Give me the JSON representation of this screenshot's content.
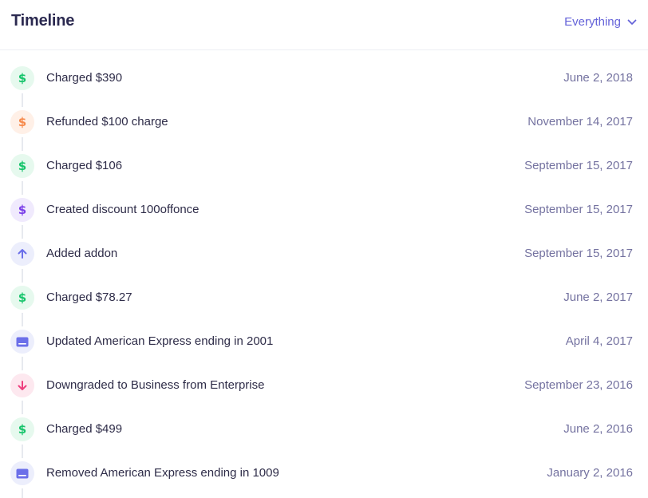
{
  "header": {
    "title": "Timeline",
    "filter_label": "Everything"
  },
  "colors": {
    "accent": "#6563d9",
    "charge": "#16c46b",
    "refund": "#f68a4c",
    "discount": "#7a3ee8",
    "upgrade": "#6b6fe9",
    "downgrade": "#ee3f7e"
  },
  "events": [
    {
      "icon": "dollar-icon",
      "tone": "green",
      "label": "Charged $390",
      "date": "June 2, 2018"
    },
    {
      "icon": "dollar-icon",
      "tone": "orange",
      "label": "Refunded $100 charge",
      "date": "November 14, 2017"
    },
    {
      "icon": "dollar-icon",
      "tone": "green",
      "label": "Charged $106",
      "date": "September 15, 2017"
    },
    {
      "icon": "dollar-icon",
      "tone": "purple",
      "label": "Created discount 100offonce",
      "date": "September 15, 2017"
    },
    {
      "icon": "arrow-up-icon",
      "tone": "indigo",
      "label": "Added addon",
      "date": "September 15, 2017"
    },
    {
      "icon": "dollar-icon",
      "tone": "green",
      "label": "Charged $78.27",
      "date": "June 2, 2017"
    },
    {
      "icon": "credit-card-icon",
      "tone": "indigo",
      "label": "Updated American Express ending in 2001",
      "date": "April 4, 2017"
    },
    {
      "icon": "arrow-down-icon",
      "tone": "pink",
      "label": "Downgraded to Business from Enterprise",
      "date": "September 23, 2016"
    },
    {
      "icon": "dollar-icon",
      "tone": "green",
      "label": "Charged $499",
      "date": "June 2, 2016"
    },
    {
      "icon": "credit-card-icon",
      "tone": "indigo",
      "label": "Removed American Express ending in 1009",
      "date": "January 2, 2016"
    }
  ]
}
